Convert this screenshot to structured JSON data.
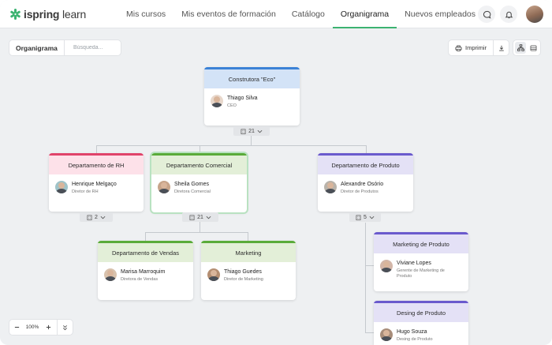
{
  "header": {
    "brand_bold": "ispring",
    "brand_light": " learn",
    "tabs": [
      {
        "label": "Mis cursos",
        "active": false
      },
      {
        "label": "Mis eventos de formación",
        "active": false
      },
      {
        "label": "Catálogo",
        "active": false
      },
      {
        "label": "Organigrama",
        "active": true
      },
      {
        "label": "Nuevos empleados",
        "active": false
      }
    ],
    "icons": [
      "chat-icon",
      "bell-icon",
      "user-avatar"
    ]
  },
  "toolbar": {
    "title": "Organigrama",
    "search_placeholder": "Búsqueda...",
    "print_label": "Imprimir"
  },
  "org": {
    "root": {
      "dept": "Construtora \"Eco\"",
      "name": "Thiago Silva",
      "role": "CEO",
      "count": "21"
    },
    "rh": {
      "dept": "Departamento de RH",
      "name": "Henrique Melgaço",
      "role": "Diretor de RH",
      "count": "2"
    },
    "comercial": {
      "dept": "Departamento Comercial",
      "name": "Sheila Gomes",
      "role": "Diretora Comercial",
      "count": "21"
    },
    "produto": {
      "dept": "Departamento de Produto",
      "name": "Alexandre Osório",
      "role": "Diretor de Produtos",
      "count": "5"
    },
    "vendas": {
      "dept": "Departamento de Vendas",
      "name": "Marisa Marroquim",
      "role": "Diretora de Vendas"
    },
    "marketing": {
      "dept": "Marketing",
      "name": "Thiago Guedes",
      "role": "Diretor de Marketing"
    },
    "mkt_produto": {
      "dept": "Marketing de Produto",
      "name": "Viviane Lopes",
      "role": "Gerente de Marketing de Produto"
    },
    "design_produto": {
      "dept": "Desing de Produto",
      "name": "Hugo Souza",
      "role": "Desing de Produto"
    }
  },
  "zoom": {
    "value": "100%"
  },
  "colors": {
    "accent": "#3cb371",
    "blue": "#3b82d6",
    "pink": "#e0436a",
    "green": "#5aab3a",
    "purple": "#6a5acd"
  }
}
